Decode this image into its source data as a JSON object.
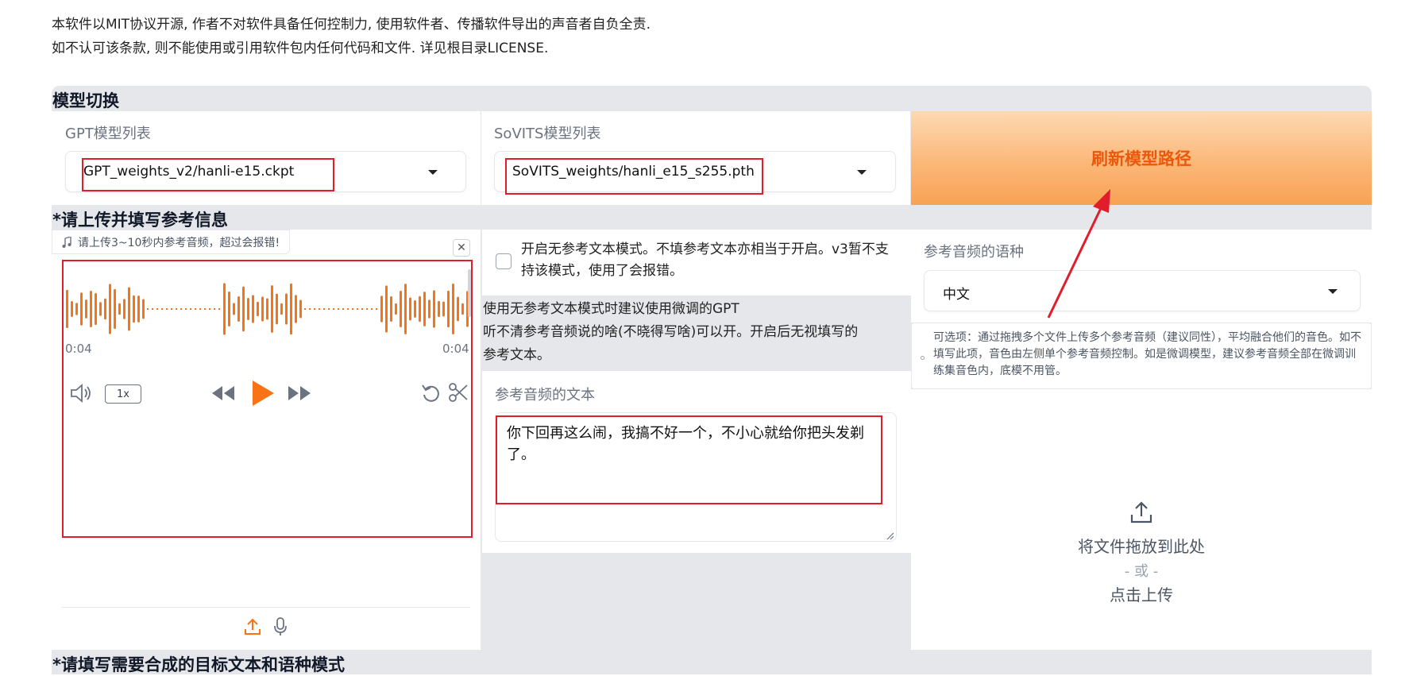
{
  "notice": {
    "line1": "本软件以MIT协议开源, 作者不对软件具备任何控制力, 使用软件者、传播软件导出的声音者自负全责.",
    "line2": "如不认可该条款, 则不能使用或引用软件包内任何代码和文件. 详见根目录LICENSE."
  },
  "model_switch": {
    "title": "模型切换",
    "gpt_label": "GPT模型列表",
    "gpt_value": "GPT_weights_v2/hanli-e15.ckpt",
    "sovits_label": "SoVITS模型列表",
    "sovits_value": "SoVITS_weights/hanli_e15_s255.pth",
    "refresh_label": "刷新模型路径"
  },
  "reference": {
    "title": "*请上传并填写参考信息",
    "audio_tag": "请上传3~10秒内参考音频，超过会报错!",
    "time_start": "0:04",
    "time_end": "0:04",
    "speed": "1x",
    "no_ref_checkbox": "开启无参考文本模式。不填参考文本亦相当于开启。v3暂不支持该模式，使用了会报错。",
    "no_ref_checked": false,
    "info_line1": "使用无参考文本模式时建议使用微调的GPT",
    "info_line2": "听不清参考音频说的啥(不晓得写啥)可以开。开启后无视填写的",
    "info_line3": "参考文本。",
    "ref_text_label": "参考音频的文本",
    "ref_text_value": "你下回再这么闹，我搞不好一个，不小心就给你把头发剃了。",
    "lang_label": "参考音频的语种",
    "lang_value": "中文",
    "multi_hint": "可选项：通过拖拽多个文件上传多个参考音频（建议同性），平均融合他们的音色。如不填写此项，音色由左侧单个参考音频控制。如是微调模型，建议参考音频全部在微调训练集音色内，底模不用管。",
    "upload_drop": "将文件拖放到此处",
    "upload_or": "- 或 -",
    "upload_click": "点击上传"
  },
  "target": {
    "title": "*请填写需要合成的目标文本和语种模式"
  },
  "colors": {
    "accent": "#f97316",
    "annotation_red": "#e11d2b",
    "section_bg": "#e5e7eb"
  }
}
